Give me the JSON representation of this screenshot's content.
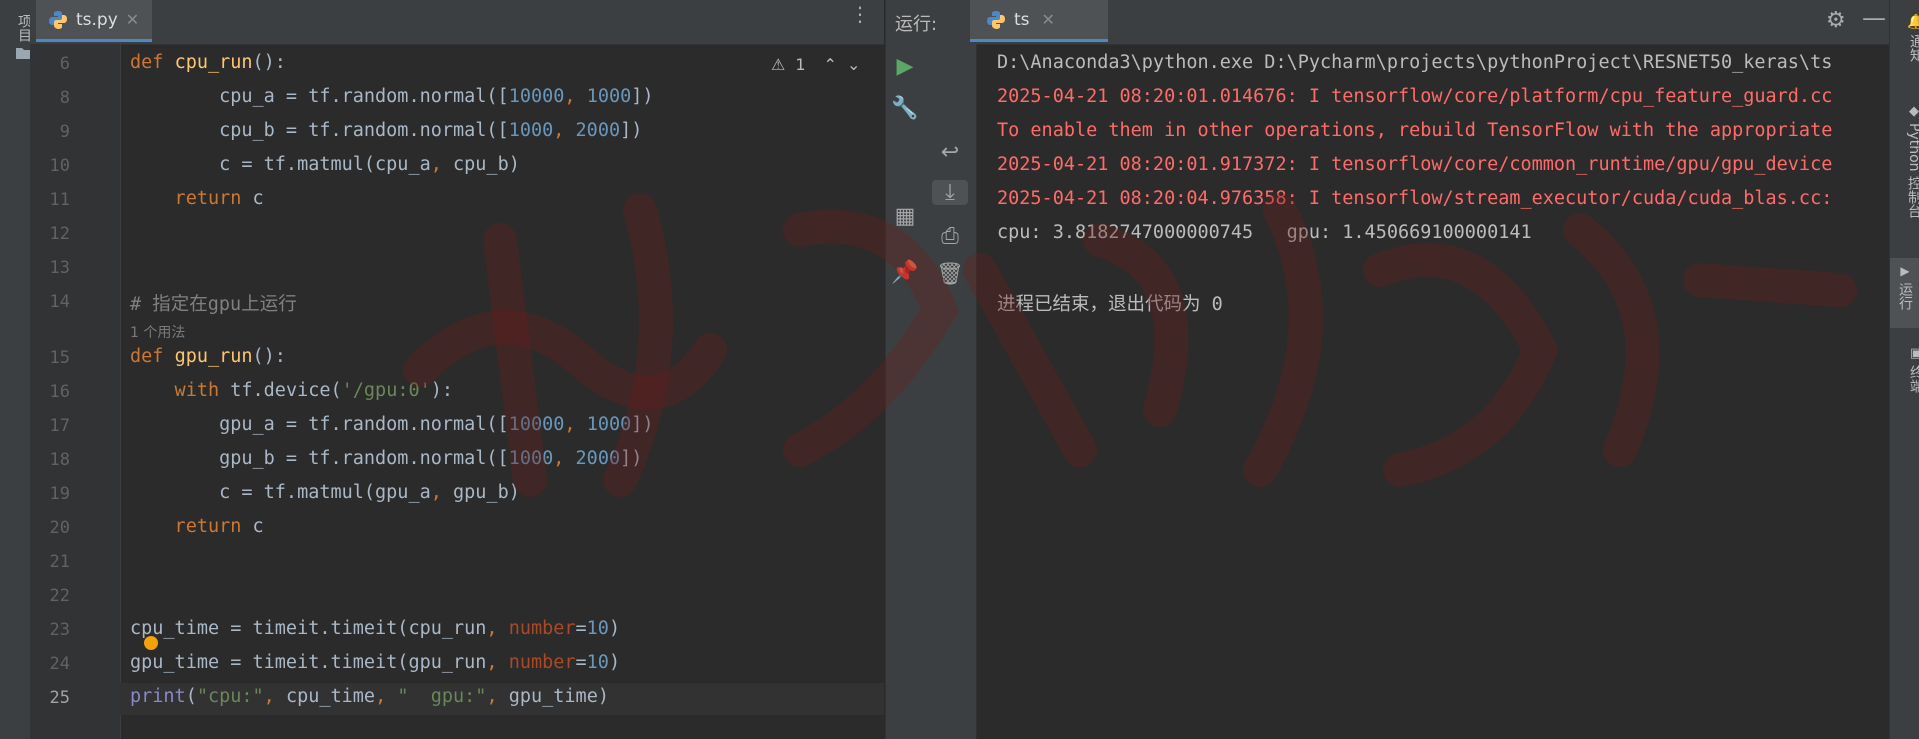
{
  "left_strip": {
    "project_label": "项目"
  },
  "editor": {
    "tab_label": "ts.py",
    "warning_count": "1",
    "usages_hint": "1 个用法",
    "lines": [
      {
        "n": "6",
        "tokens": [
          [
            "kw",
            "def "
          ],
          [
            "fn",
            "cpu_run"
          ],
          [
            "",
            "():"
          ]
        ]
      },
      {
        "n": "8",
        "tokens": [
          [
            "",
            "        cpu_a = tf.random.normal(["
          ],
          [
            "num",
            "10000"
          ],
          [
            "kw",
            ", "
          ],
          [
            "num",
            "1000"
          ],
          [
            "",
            "])"
          ]
        ]
      },
      {
        "n": "9",
        "tokens": [
          [
            "",
            "        cpu_b = tf.random.normal(["
          ],
          [
            "num",
            "1000"
          ],
          [
            "kw",
            ", "
          ],
          [
            "num",
            "2000"
          ],
          [
            "",
            "])"
          ]
        ]
      },
      {
        "n": "10",
        "tokens": [
          [
            "",
            "        c = tf.matmul(cpu_a"
          ],
          [
            "kw",
            ", "
          ],
          [
            "",
            "cpu_b)"
          ]
        ]
      },
      {
        "n": "11",
        "tokens": [
          [
            "kw",
            "    return "
          ],
          [
            "",
            "c"
          ]
        ]
      },
      {
        "n": "12",
        "tokens": []
      },
      {
        "n": "13",
        "tokens": []
      },
      {
        "n": "14",
        "tokens": [
          [
            "cmt",
            "# 指定在gpu上运行"
          ]
        ]
      },
      {
        "n": "15",
        "tokens": [
          [
            "kw",
            "def "
          ],
          [
            "fn",
            "gpu_run"
          ],
          [
            "",
            "():"
          ]
        ]
      },
      {
        "n": "16",
        "tokens": [
          [
            "kw",
            "    with "
          ],
          [
            "",
            "tf.device("
          ],
          [
            "str",
            "'/gpu:0'"
          ],
          [
            "",
            "):"
          ]
        ]
      },
      {
        "n": "17",
        "tokens": [
          [
            "",
            "        gpu_a = tf.random.normal(["
          ],
          [
            "num",
            "10000"
          ],
          [
            "kw",
            ", "
          ],
          [
            "num",
            "1000"
          ],
          [
            "",
            "])"
          ]
        ]
      },
      {
        "n": "18",
        "tokens": [
          [
            "",
            "        gpu_b = tf.random.normal(["
          ],
          [
            "num",
            "1000"
          ],
          [
            "kw",
            ", "
          ],
          [
            "num",
            "2000"
          ],
          [
            "",
            "])"
          ]
        ]
      },
      {
        "n": "19",
        "tokens": [
          [
            "",
            "        c = tf.matmul(gpu_a"
          ],
          [
            "kw",
            ", "
          ],
          [
            "",
            "gpu_b)"
          ]
        ]
      },
      {
        "n": "20",
        "tokens": [
          [
            "kw",
            "    return "
          ],
          [
            "",
            "c"
          ]
        ]
      },
      {
        "n": "21",
        "tokens": []
      },
      {
        "n": "22",
        "tokens": []
      },
      {
        "n": "23",
        "tokens": [
          [
            "",
            "cpu_time = timeit.timeit(cpu_run"
          ],
          [
            "kw",
            ", "
          ],
          [
            "param",
            "number"
          ],
          [
            "",
            "="
          ],
          [
            "num",
            "10"
          ],
          [
            "",
            ")"
          ]
        ]
      },
      {
        "n": "24",
        "tokens": [
          [
            "",
            "gpu_time = timeit.timeit(gpu_run"
          ],
          [
            "kw",
            ", "
          ],
          [
            "param",
            "number"
          ],
          [
            "",
            "="
          ],
          [
            "num",
            "10"
          ],
          [
            "",
            ")"
          ]
        ]
      },
      {
        "n": "25",
        "tokens": [
          [
            "bi",
            "print"
          ],
          [
            "",
            "("
          ],
          [
            "str",
            "\"cpu:\""
          ],
          [
            "kw",
            ", "
          ],
          [
            "",
            "cpu_time"
          ],
          [
            "kw",
            ", "
          ],
          [
            "str",
            "\"  gpu:\""
          ],
          [
            "kw",
            ", "
          ],
          [
            "",
            "gpu_time)"
          ]
        ]
      }
    ]
  },
  "run": {
    "title": "运行:",
    "tab_label": "ts",
    "output": [
      {
        "style": "normal",
        "text": "D:\\Anaconda3\\python.exe D:\\Pycharm\\projects\\pythonProject\\RESNET50_keras\\ts"
      },
      {
        "style": "red",
        "text": "2025-04-21 08:20:01.014676: I tensorflow/core/platform/cpu_feature_guard.cc"
      },
      {
        "style": "red",
        "text": "To enable them in other operations, rebuild TensorFlow with the appropriate"
      },
      {
        "style": "red",
        "text": "2025-04-21 08:20:01.917372: I tensorflow/core/common_runtime/gpu/gpu_device"
      },
      {
        "style": "red",
        "text": "2025-04-21 08:20:04.976358: I tensorflow/stream_executor/cuda/cuda_blas.cc:"
      },
      {
        "style": "normal",
        "text": "cpu: 3.8182747000000745   gpu: 1.450669100000141"
      },
      {
        "style": "normal",
        "text": ""
      },
      {
        "style": "normal",
        "text": "进程已结束，退出代码为 0"
      }
    ]
  },
  "right_strip": {
    "notifications_label": "通知",
    "python_console_label": "Python 控制台",
    "run_label": "运行",
    "terminal_label": "终端"
  },
  "colors": {
    "background": "#2b2b2b",
    "keyword": "#cc7832",
    "function": "#ffc66d",
    "number": "#6897bb",
    "string": "#6a8759",
    "error_output": "#ff6b68"
  }
}
